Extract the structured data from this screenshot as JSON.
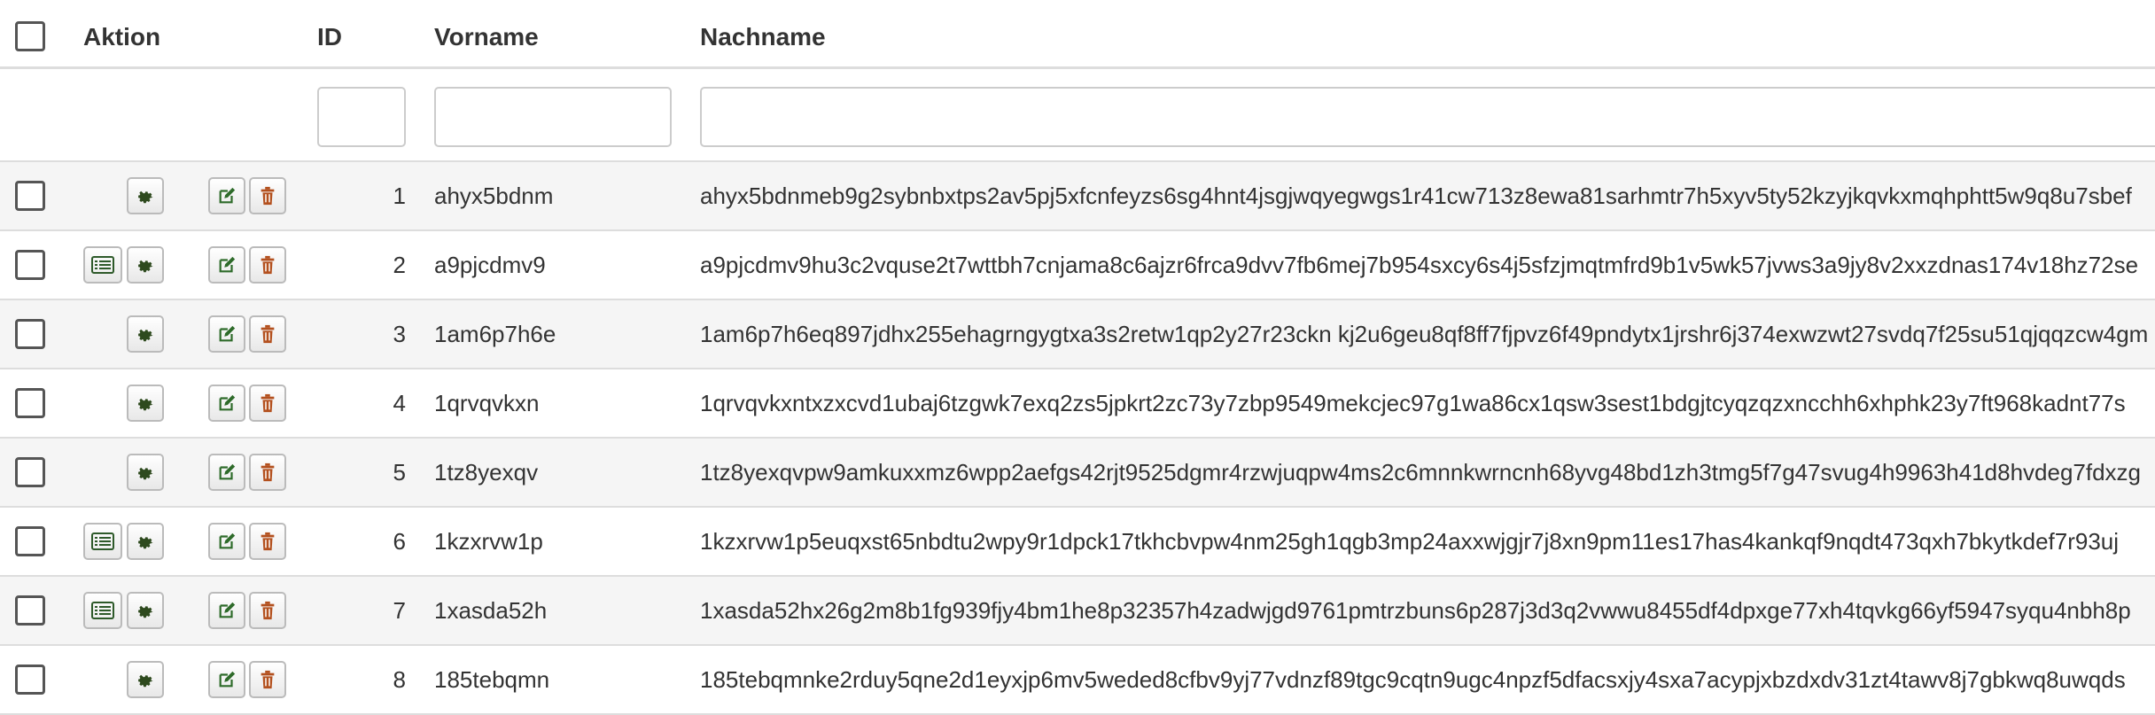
{
  "header": {
    "aktion": "Aktion",
    "id": "ID",
    "vorname": "Vorname",
    "nachname": "Nachname"
  },
  "filters": {
    "id_value": "",
    "vorname_value": "",
    "nachname_value": ""
  },
  "colors": {
    "gear": "#2e4a1e",
    "edit": "#2e6b2a",
    "delete": "#b3501e",
    "list": "#2e5a2a"
  },
  "rows": [
    {
      "id": "1",
      "vorname": "ahyx5bdnm",
      "nachname": "ahyx5bdnmeb9g2sybnbxtps2av5pj5xfcnfeyzs6sg4hnt4jsgjwqyegwgs1r41cw713z8ewa81sarhmtr7h5xyv5ty52kzyjkqvkxmqhphtt5w9q8u7sbef",
      "has_list": false
    },
    {
      "id": "2",
      "vorname": "a9pjcdmv9",
      "nachname": "a9pjcdmv9hu3c2vquse2t7wttbh7cnjama8c6ajzr6frca9dvv7fb6mej7b954sxcy6s4j5sfzjmqtmfrd9b1v5wk57jvws3a9jy8v2xxzdnas174v18hz72se",
      "has_list": true
    },
    {
      "id": "3",
      "vorname": "1am6p7h6e",
      "nachname": "1am6p7h6eq897jdhx255ehagrngygtxa3s2retw1qp2y27r23ckn kj2u6geu8qf8ff7fjpvz6f49pndytx1jrshr6j374exwzwt27svdq7f25su51qjqqzcw4gm",
      "has_list": false
    },
    {
      "id": "4",
      "vorname": "1qrvqvkxn",
      "nachname": "1qrvqvkxntxzxcvd1ubaj6tzgwk7exq2zs5jpkrt2zc73y7zbp9549mekcjec97g1wa86cx1qsw3sest1bdgjtcyqzqzxncchh6xhphk23y7ft968kadnt77s",
      "has_list": false
    },
    {
      "id": "5",
      "vorname": "1tz8yexqv",
      "nachname": "1tz8yexqvpw9amkuxxmz6wpp2aefgs42rjt9525dgmr4rzwjuqpw4ms2c6mnnkwrncnh68yvg48bd1zh3tmg5f7g47svug4h9963h41d8hvdeg7fdxzg",
      "has_list": false
    },
    {
      "id": "6",
      "vorname": "1kzxrvw1p",
      "nachname": "1kzxrvw1p5euqxst65nbdtu2wpy9r1dpck17tkhcbvpw4nm25gh1qgb3mp24axxwjgjr7j8xn9pm11es17has4kankqf9nqdt473qxh7bkytkdef7r93uj",
      "has_list": true
    },
    {
      "id": "7",
      "vorname": "1xasda52h",
      "nachname": "1xasda52hx26g2m8b1fg939fjy4bm1he8p32357h4zadwjgd9761pmtrzbuns6p287j3d3q2vwwu8455df4dpxge77xh4tqvkg66yf5947syqu4nbh8p",
      "has_list": true
    },
    {
      "id": "8",
      "vorname": "185tebqmn",
      "nachname": "185tebqmnke2rduy5qne2d1eyxjp6mv5weded8cfbv9yj77vdnzf89tgc9cqtn9ugc4npzf5dfacsxjy4sxa7acypjxbzdxdv31zt4tawv8j7gbkwq8uwqds",
      "has_list": false
    }
  ]
}
